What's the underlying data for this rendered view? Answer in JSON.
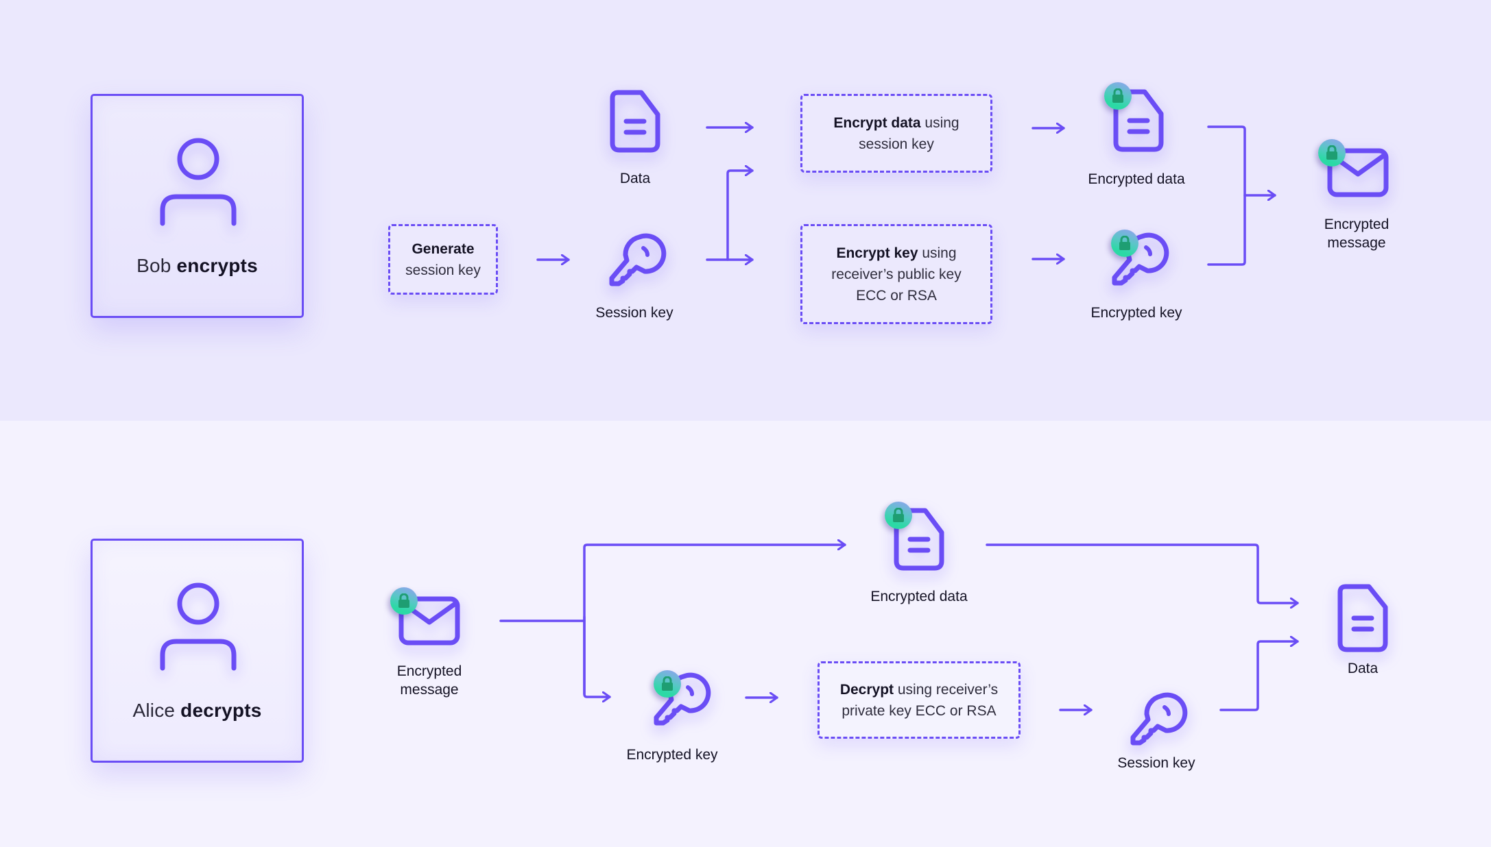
{
  "colors": {
    "accent": "#6a4df5",
    "top_background": "#ebe8fd",
    "bottom_background": "#f4f2fe",
    "badge_green": "#2cd9a5",
    "badge_blue": "#93a0f2",
    "lock_glyph": "#1e9e72",
    "text": "#141224"
  },
  "encrypt_flow": {
    "actor": {
      "name": "Bob",
      "action": "encrypts",
      "icon": "person-icon"
    },
    "generate_step": {
      "bold": "Generate",
      "text": "session key"
    },
    "nodes": {
      "data": {
        "label": "Data",
        "icon": "document-icon"
      },
      "session_key": {
        "label": "Session key",
        "icon": "key-icon"
      },
      "encrypted_data": {
        "label": "Encrypted data",
        "icon": "locked-document-icon"
      },
      "encrypted_key": {
        "label": "Encrypted key",
        "icon": "locked-key-icon"
      },
      "encrypted_message": {
        "label_line1": "Encrypted",
        "label_line2": "message",
        "icon": "locked-envelope-icon"
      }
    },
    "encrypt_data_step": {
      "bold": "Encrypt data",
      "text1": " using",
      "text2": "session key"
    },
    "encrypt_key_step": {
      "bold": "Encrypt key",
      "text1": " using",
      "text2": "receiver’s public key",
      "text3": "ECC or RSA"
    }
  },
  "decrypt_flow": {
    "actor": {
      "name": "Alice",
      "action": "decrypts",
      "icon": "person-icon"
    },
    "nodes": {
      "encrypted_message": {
        "label_line1": "Encrypted",
        "label_line2": "message",
        "icon": "locked-envelope-icon"
      },
      "encrypted_data": {
        "label": "Encrypted data",
        "icon": "locked-document-icon"
      },
      "encrypted_key": {
        "label": "Encrypted key",
        "icon": "locked-key-icon"
      },
      "session_key": {
        "label": "Session key",
        "icon": "key-icon"
      },
      "data": {
        "label": "Data",
        "icon": "document-icon"
      }
    },
    "decrypt_step": {
      "bold": "Decrypt",
      "text1": " using receiver’s",
      "text2": "private key ECC or RSA"
    }
  }
}
